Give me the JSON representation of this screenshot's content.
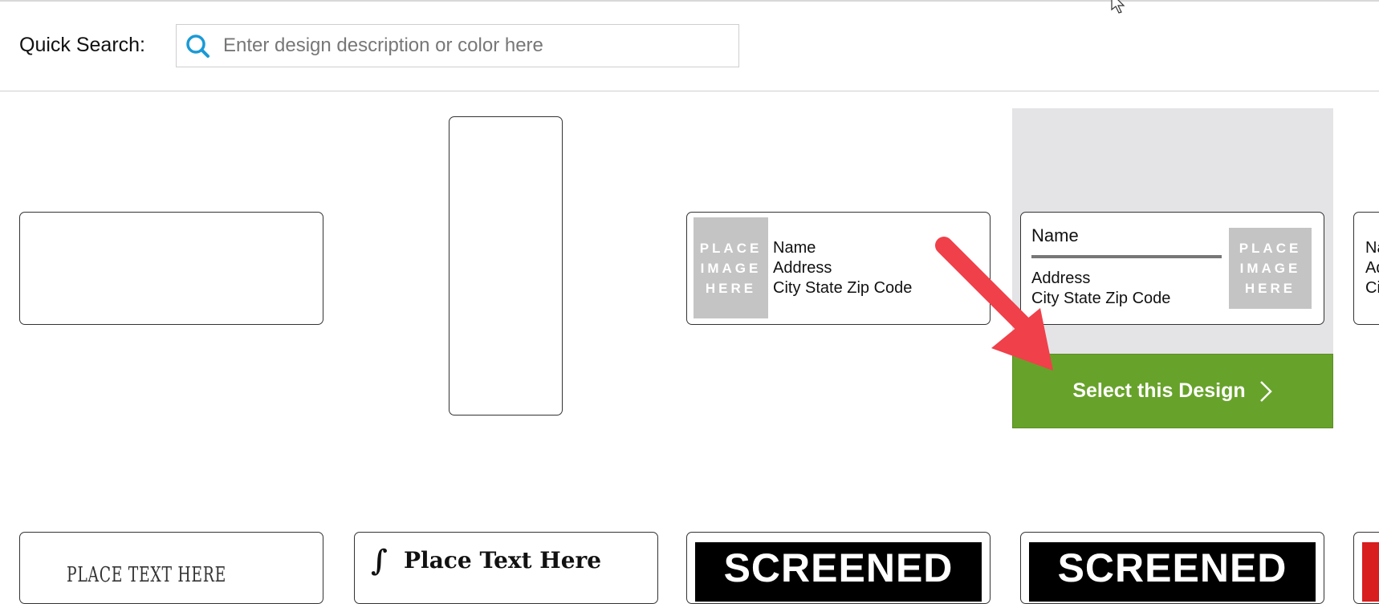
{
  "search": {
    "label": "Quick Search:",
    "placeholder": "Enter design description or color here"
  },
  "designs_row1": [
    {
      "type": "blank-horizontal"
    },
    {
      "type": "blank-vertical"
    },
    {
      "image_text": [
        "PLACE",
        "IMAGE",
        "HERE"
      ],
      "lines": [
        "Name",
        "Address",
        "City State Zip Code"
      ]
    },
    {
      "name": "Name",
      "lines": [
        "Address",
        "City State Zip Code"
      ],
      "image_text": [
        "PLACE",
        "IMAGE",
        "HERE"
      ],
      "select_label": "Select this Design"
    },
    {
      "lines_partial": [
        "Na",
        "Ad",
        "Ci"
      ]
    }
  ],
  "designs_row2": [
    {
      "text": "PLACE TEXT HERE"
    },
    {
      "text": "Place Text Here"
    },
    {
      "text": "SCREENED"
    },
    {
      "text": "SCREENED"
    }
  ],
  "colors": {
    "select_button": "#67a22a",
    "hover_panel": "#e4e4e6",
    "arrow": "#f0404a",
    "search_icon": "#1a9ad6"
  }
}
